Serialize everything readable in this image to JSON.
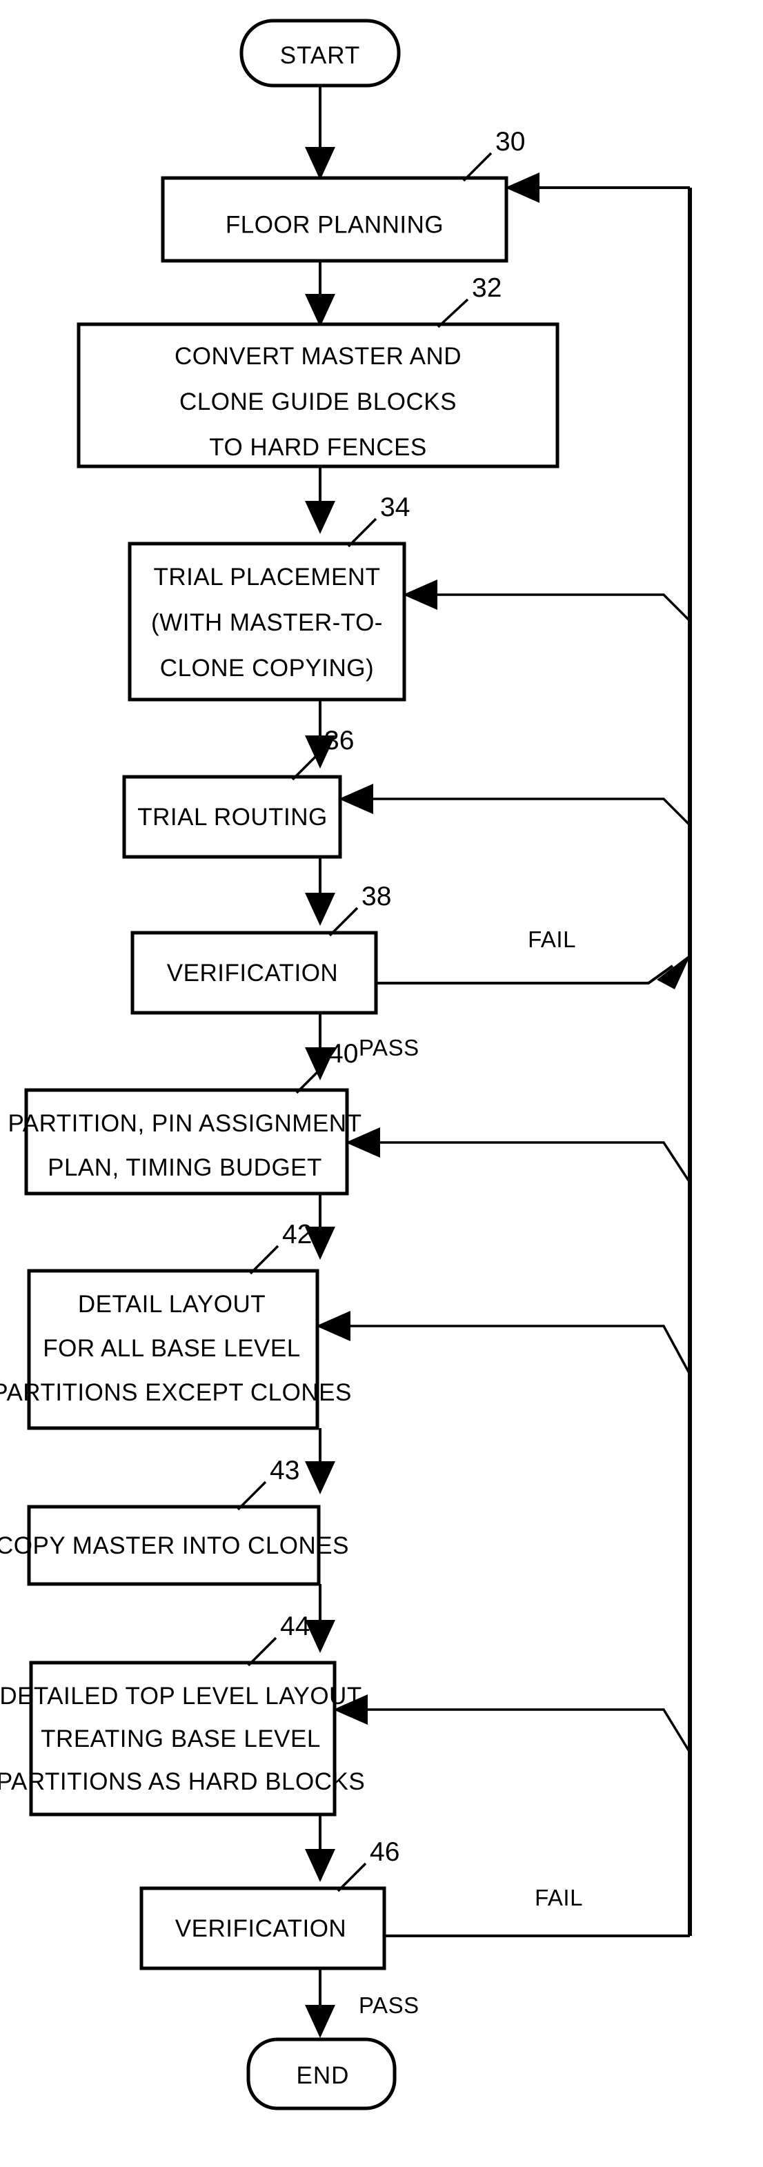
{
  "diagram": {
    "title": "IC Physical Design Flow with Master/Clone Handling",
    "kind": "flowchart",
    "stroke_color": "#000000",
    "background_color": "#ffffff"
  },
  "nodes": [
    {
      "id": "start",
      "ref": "",
      "shape": "terminator",
      "lines": [
        "START"
      ]
    },
    {
      "id": "n30",
      "ref": "30",
      "shape": "process",
      "lines": [
        "FLOOR PLANNING"
      ]
    },
    {
      "id": "n32",
      "ref": "32",
      "shape": "process",
      "lines": [
        "CONVERT MASTER AND",
        "CLONE GUIDE BLOCKS",
        "TO HARD FENCES"
      ]
    },
    {
      "id": "n34",
      "ref": "34",
      "shape": "process",
      "lines": [
        "TRIAL PLACEMENT",
        "(WITH MASTER-TO-",
        "CLONE COPYING)"
      ]
    },
    {
      "id": "n36",
      "ref": "36",
      "shape": "process",
      "lines": [
        "TRIAL ROUTING"
      ]
    },
    {
      "id": "n38",
      "ref": "38",
      "shape": "process",
      "lines": [
        "VERIFICATION"
      ]
    },
    {
      "id": "n40",
      "ref": "40",
      "shape": "process",
      "lines": [
        "PARTITION, PIN ASSIGNMENT",
        "PLAN, TIMING BUDGET"
      ]
    },
    {
      "id": "n42",
      "ref": "42",
      "shape": "process",
      "lines": [
        "DETAIL LAYOUT",
        "FOR ALL BASE LEVEL",
        "PARTITIONS EXCEPT CLONES"
      ]
    },
    {
      "id": "n43",
      "ref": "43",
      "shape": "process",
      "lines": [
        "COPY MASTER INTO CLONES"
      ]
    },
    {
      "id": "n44",
      "ref": "44",
      "shape": "process",
      "lines": [
        "DETAILED TOP LEVEL LAYOUT",
        "TREATING BASE LEVEL",
        "PARTITIONS AS HARD BLOCKS"
      ]
    },
    {
      "id": "n46",
      "ref": "46",
      "shape": "process",
      "lines": [
        "VERIFICATION"
      ]
    },
    {
      "id": "end",
      "ref": "",
      "shape": "terminator",
      "lines": [
        "END"
      ]
    }
  ],
  "edge_labels": {
    "fail_38": "FAIL",
    "pass_38": "PASS",
    "fail_46": "FAIL",
    "pass_46": "PASS"
  },
  "reference_numerals": [
    "30",
    "32",
    "34",
    "36",
    "38",
    "40",
    "42",
    "43",
    "44",
    "46"
  ]
}
